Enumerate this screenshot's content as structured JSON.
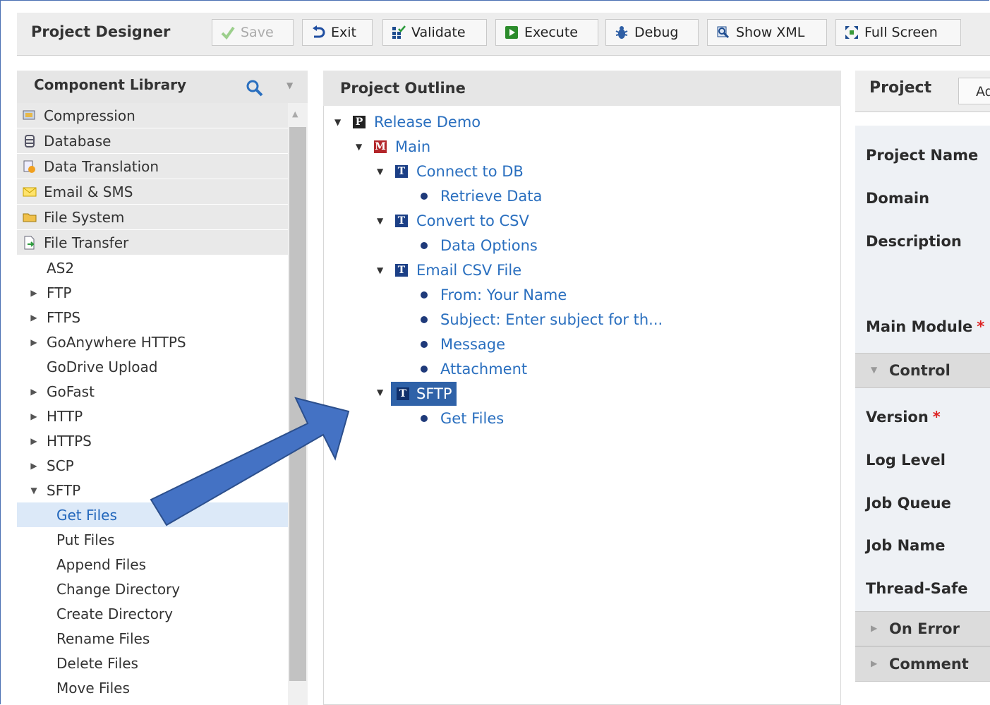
{
  "toolbar": {
    "title": "Project Designer",
    "buttons": {
      "save": "Save",
      "exit": "Exit",
      "validate": "Validate",
      "execute": "Execute",
      "debug": "Debug",
      "show_xml": "Show XML",
      "full_screen": "Full Screen"
    }
  },
  "library": {
    "title": "Component Library",
    "categories": [
      "Compression",
      "Database",
      "Data Translation",
      "Email & SMS",
      "File System",
      "File Transfer"
    ],
    "items": [
      "AS2",
      "FTP",
      "FTPS",
      "GoAnywhere HTTPS",
      "GoDrive Upload",
      "GoFast",
      "HTTP",
      "HTTPS",
      "SCP",
      "SFTP"
    ],
    "sftp_children": [
      "Get Files",
      "Put Files",
      "Append Files",
      "Change Directory",
      "Create Directory",
      "Rename Files",
      "Delete Files",
      "Move Files"
    ]
  },
  "outline": {
    "title": "Project Outline",
    "project": "Release Demo",
    "module": "Main",
    "tasks": [
      {
        "name": "Connect to DB",
        "children": [
          "Retrieve Data"
        ]
      },
      {
        "name": "Convert to CSV",
        "children": [
          "Data Options"
        ]
      },
      {
        "name": "Email CSV File",
        "children": [
          "From: Your Name",
          "Subject: Enter subject for th...",
          "Message",
          "Attachment"
        ]
      },
      {
        "name": "SFTP",
        "children": [
          "Get Files"
        ]
      }
    ]
  },
  "properties": {
    "title": "Project",
    "add_label": "Ad",
    "fields": {
      "project_name": "Project Name",
      "domain": "Domain",
      "description": "Description",
      "main_module": "Main Module",
      "version": "Version",
      "log_level": "Log Level",
      "job_queue": "Job Queue",
      "job_name": "Job Name",
      "thread_safe": "Thread-Safe"
    },
    "required_mark": "*",
    "sections": {
      "control": "Control",
      "on_error": "On Error",
      "comment": "Comment"
    }
  },
  "colors": {
    "accent": "#2f62a8",
    "link": "#2a6fbf",
    "arrow": "#4472c4"
  }
}
